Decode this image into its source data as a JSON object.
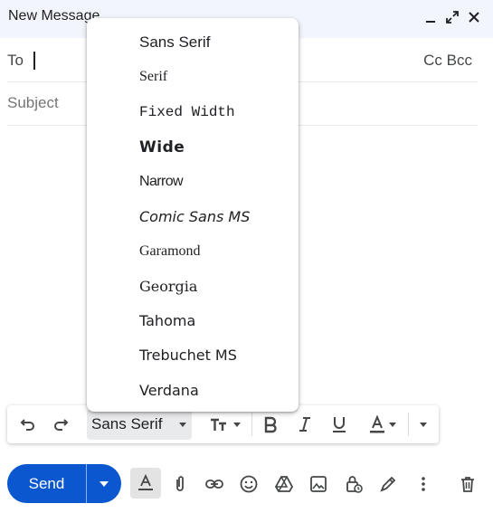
{
  "window": {
    "title": "New Message",
    "controls": [
      "minimize-icon",
      "expand-icon",
      "close-icon"
    ]
  },
  "recipients": {
    "to_label": "To",
    "to_value": "",
    "cc_bcc_label": "Cc Bcc"
  },
  "subject": {
    "placeholder": "Subject",
    "value": ""
  },
  "font_menu": {
    "items": [
      {
        "label": "Sans Serif"
      },
      {
        "label": "Serif"
      },
      {
        "label": "Fixed Width"
      },
      {
        "label": "Wide"
      },
      {
        "label": "Narrow"
      },
      {
        "label": "Comic Sans MS"
      },
      {
        "label": "Garamond"
      },
      {
        "label": "Georgia"
      },
      {
        "label": "Tahoma"
      },
      {
        "label": "Trebuchet MS"
      },
      {
        "label": "Verdana"
      }
    ]
  },
  "format_toolbar": {
    "font_value": "Sans Serif",
    "buttons": [
      "undo-icon",
      "redo-icon",
      "text-size-icon",
      "bold-icon",
      "italic-icon",
      "underline-icon",
      "text-color-icon",
      "more-formatting-icon"
    ]
  },
  "actions": {
    "send_label": "Send",
    "icons": [
      "formatting-options-icon",
      "attach-icon",
      "link-icon",
      "emoji-icon",
      "drive-icon",
      "photo-icon",
      "confidential-icon",
      "signature-icon",
      "more-options-icon",
      "discard-icon"
    ]
  },
  "colors": {
    "accent": "#0b57d0",
    "header_bg": "#f2f6fc"
  }
}
